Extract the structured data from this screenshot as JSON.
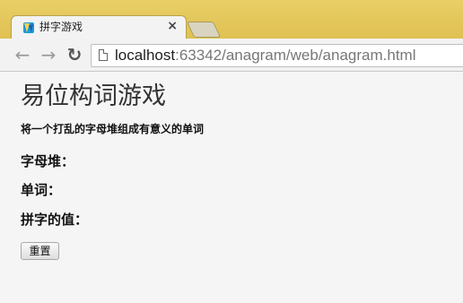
{
  "browser": {
    "tab": {
      "title": "拼字游戏",
      "close_glyph": "×",
      "favicon": "webstorm-icon"
    },
    "nav": {
      "back_glyph": "←",
      "forward_glyph": "→",
      "reload_glyph": "↻"
    },
    "address_bar": {
      "host": "localhost",
      "rest": ":63342/anagram/web/anagram.html"
    }
  },
  "page": {
    "heading": "易位构词游戏",
    "instructions": "将一个打乱的字母堆组成有意义的单词",
    "labels": {
      "letters": "字母堆：",
      "word": "单词：",
      "score": "拼字的值："
    },
    "reset_button": "重置"
  }
}
